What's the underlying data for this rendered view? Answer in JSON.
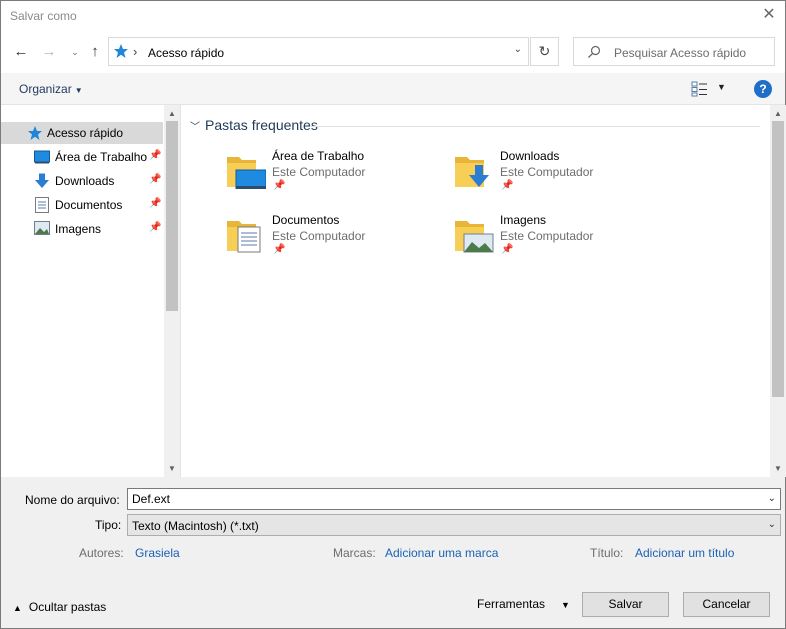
{
  "window": {
    "title": "Salvar como"
  },
  "address": {
    "crumb": "Acesso rápido"
  },
  "search": {
    "placeholder": "Pesquisar Acesso rápido"
  },
  "toolbar": {
    "organize": "Organizar"
  },
  "sidebar": {
    "items": [
      {
        "label": "Acesso rápido",
        "icon": "quick-access-star-icon",
        "selected": true
      },
      {
        "label": "Área de Trabalho",
        "icon": "desktop-icon",
        "pinned": true
      },
      {
        "label": "Downloads",
        "icon": "downloads-arrow-icon",
        "pinned": true
      },
      {
        "label": "Documentos",
        "icon": "documents-icon",
        "pinned": true
      },
      {
        "label": "Imagens",
        "icon": "pictures-icon",
        "pinned": true
      }
    ]
  },
  "content": {
    "group": "Pastas frequentes",
    "tiles": [
      {
        "name": "Área de Trabalho",
        "sub": "Este Computador"
      },
      {
        "name": "Downloads",
        "sub": "Este Computador"
      },
      {
        "name": "Documentos",
        "sub": "Este Computador"
      },
      {
        "name": "Imagens",
        "sub": "Este Computador"
      }
    ]
  },
  "form": {
    "filename_label": "Nome do arquivo:",
    "filename_value": "Def.ext",
    "type_label": "Tipo:",
    "type_value": "Texto (Macintosh) (*.txt)",
    "authors_label": "Autores:",
    "authors_value": "Grasiela",
    "tags_label": "Marcas:",
    "tags_value": "Adicionar uma marca",
    "title_label": "Título:",
    "title_value": "Adicionar um título"
  },
  "footer": {
    "hide_folders": "Ocultar pastas",
    "tools": "Ferramentas",
    "save": "Salvar",
    "cancel": "Cancelar"
  },
  "colors": {
    "accent": "#1a62b5",
    "folder": "#f5c542",
    "selection": "#d9d9d9"
  }
}
